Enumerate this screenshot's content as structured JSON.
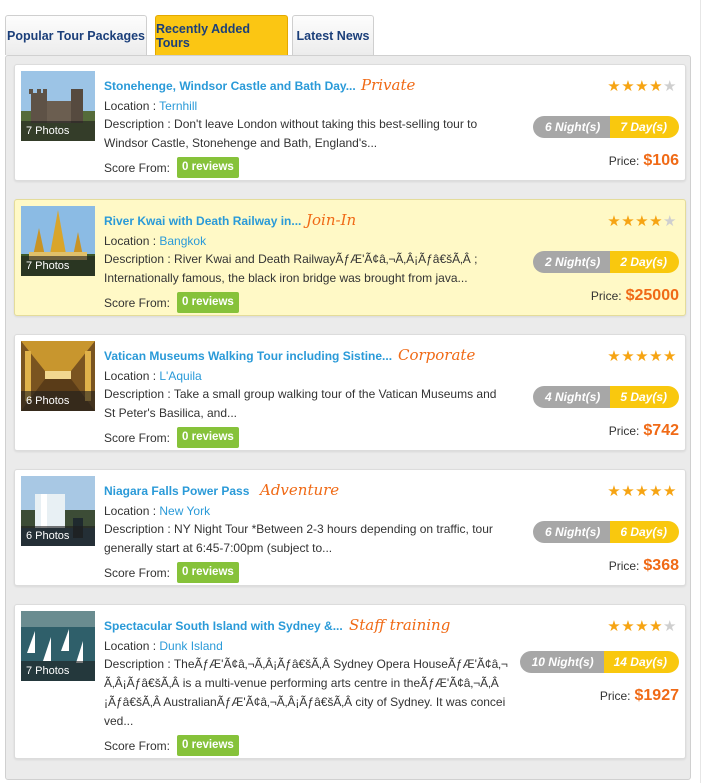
{
  "tabs": [
    {
      "label": "Popular Tour Packages",
      "active": false
    },
    {
      "label": "Recently Added Tours",
      "active": true
    },
    {
      "label": "Latest News",
      "active": false
    }
  ],
  "colors": {
    "accent": "#f06a16",
    "link": "#2a9ad8",
    "tab_active": "#fbc613",
    "reviews": "#86c23a",
    "stars": "#f6a413"
  },
  "labels": {
    "location": "Location : ",
    "description": "Description : ",
    "score_from": "Score From:",
    "price": "Price:"
  },
  "tours": [
    {
      "title": "Stonehenge, Windsor Castle and Bath Day...",
      "category": "Private",
      "location": "Ternhill",
      "description": "Don't leave London without taking this best-selling tour to Windsor Castle, Stonehenge and Bath, England's...",
      "photos": "7 Photos",
      "reviews": "0 reviews",
      "stars": 4,
      "nights": "6 Night(s)",
      "days": "7 Day(s)",
      "price": "$106",
      "highlight": false,
      "thumb": "castle"
    },
    {
      "title": "River Kwai with Death Railway in...",
      "category": "Join-In",
      "location": "Bangkok",
      "description": "River Kwai and Death RailwayÃƒÆ'Ã¢â‚¬Ã‚Â¡Ãƒâ€šÃ‚Â ; Internationally famous, the black iron bridge was brought from java...",
      "photos": "7 Photos",
      "reviews": "0 reviews",
      "stars": 4,
      "nights": "2 Night(s)",
      "days": "2 Day(s)",
      "price": "$25000",
      "highlight": true,
      "thumb": "temple"
    },
    {
      "title": "Vatican Museums Walking Tour including Sistine...",
      "category": "Corporate",
      "location": "L'Aquila",
      "description": "Take a small group walking tour of the Vatican Museums and St Peter's Basilica, and...",
      "photos": "6 Photos",
      "reviews": "0 reviews",
      "stars": 5,
      "nights": "4 Night(s)",
      "days": "5 Day(s)",
      "price": "$742",
      "highlight": false,
      "thumb": "gallery"
    },
    {
      "title": "Niagara Falls Power Pass",
      "category": "Adventure",
      "location": "New York",
      "description": "NY Night Tour *Between 2-3 hours depending on traffic, tour generally start at 6:45-7:00pm (subject to...",
      "photos": "6 Photos",
      "reviews": "0 reviews",
      "stars": 5,
      "nights": "6 Night(s)",
      "days": "6 Day(s)",
      "price": "$368",
      "highlight": false,
      "thumb": "falls"
    },
    {
      "title": "Spectacular South Island with Sydney &...",
      "category": "Staff training",
      "location": "Dunk Island",
      "description": "TheÃƒÆ'Ã¢â‚¬Ã‚Â¡Ãƒâ€šÃ‚Â Sydney Opera HouseÃƒÆ'Ã¢â‚¬Ã‚Â¡Ãƒâ€šÃ‚Â is a multi-venue performing arts centre in theÃƒÆ'Ã¢â‚¬Ã‚Â¡Ãƒâ€šÃ‚Â AustralianÃƒÆ'Ã¢â‚¬Ã‚Â¡Ãƒâ€šÃ‚Â city of Sydney. It was conceived...",
      "photos": "7 Photos",
      "reviews": "0 reviews",
      "stars": 4,
      "nights": "10 Night(s)",
      "days": "14 Day(s)",
      "price": "$1927",
      "highlight": false,
      "thumb": "sails"
    }
  ]
}
